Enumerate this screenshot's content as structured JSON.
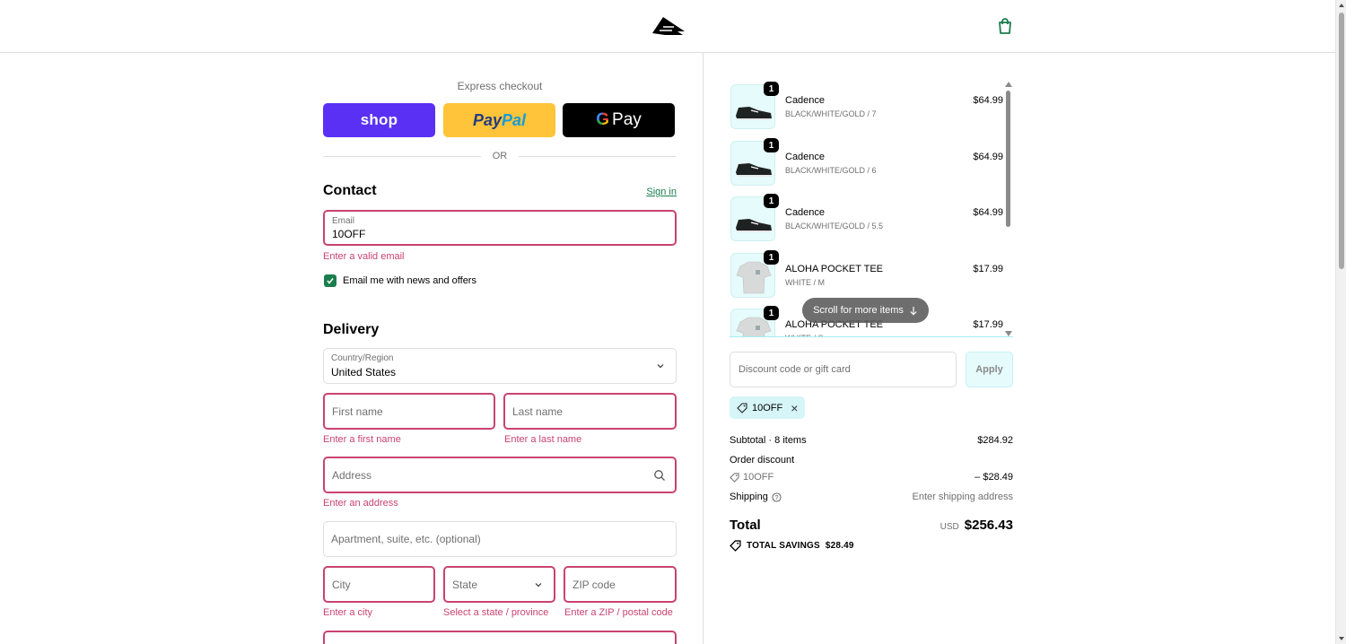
{
  "header": {
    "logo_icon": "emerica-wing-logo",
    "cart_icon": "shopping-bag-icon"
  },
  "express": {
    "title": "Express checkout",
    "shop_label": "shop",
    "paypal_part1": "Pay",
    "paypal_part2": "Pal",
    "gpay_g": "G",
    "gpay_label": "Pay",
    "or_label": "OR"
  },
  "contact": {
    "title": "Contact",
    "sign_in": "Sign in",
    "email_label": "Email",
    "email_value": "10OFF",
    "email_error": "Enter a valid email",
    "news_checkbox_label": "Email me with news and offers",
    "news_checked": true
  },
  "delivery": {
    "title": "Delivery",
    "country_label": "Country/Region",
    "country_value": "United States",
    "first_name_placeholder": "First name",
    "first_name_error": "Enter a first name",
    "last_name_placeholder": "Last name",
    "last_name_error": "Enter a last name",
    "address_placeholder": "Address",
    "address_error": "Enter an address",
    "apartment_placeholder": "Apartment, suite, etc. (optional)",
    "city_placeholder": "City",
    "city_error": "Enter a city",
    "state_placeholder": "State",
    "state_error": "Select a state / province",
    "zip_placeholder": "ZIP code",
    "zip_error": "Enter a ZIP / postal code"
  },
  "cart": {
    "items": [
      {
        "name": "Cadence",
        "variant": "BLACK/WHITE/GOLD / 7",
        "price": "$64.99",
        "qty": "1",
        "kind": "shoe"
      },
      {
        "name": "Cadence",
        "variant": "BLACK/WHITE/GOLD / 6",
        "price": "$64.99",
        "qty": "1",
        "kind": "shoe"
      },
      {
        "name": "Cadence",
        "variant": "BLACK/WHITE/GOLD / 5.5",
        "price": "$64.99",
        "qty": "1",
        "kind": "shoe"
      },
      {
        "name": "ALOHA POCKET TEE",
        "variant": "WHITE / M",
        "price": "$17.99",
        "qty": "1",
        "kind": "tee"
      },
      {
        "name": "ALOHA POCKET TEE",
        "variant": "WHITE / S",
        "price": "$17.99",
        "qty": "1",
        "kind": "tee"
      }
    ],
    "scroll_hint": "Scroll for more items",
    "discount_placeholder": "Discount code or gift card",
    "apply_label": "Apply",
    "applied_code": "10OFF"
  },
  "summary": {
    "subtotal_label": "Subtotal · 8 items",
    "subtotal_value": "$284.92",
    "order_discount_label": "Order discount",
    "discount_code": "10OFF",
    "discount_value": "– $28.49",
    "shipping_label": "Shipping",
    "shipping_value": "Enter shipping address",
    "total_label": "Total",
    "currency": "USD",
    "total_value": "$256.43",
    "savings_label": "TOTAL SAVINGS",
    "savings_value": "$28.49"
  },
  "colors": {
    "accent": "#1a7d4d",
    "error": "#c9436f",
    "shop_purple": "#5a31f4",
    "paypal_yellow": "#ffc439",
    "thumb_bg": "#e6fbfb"
  }
}
